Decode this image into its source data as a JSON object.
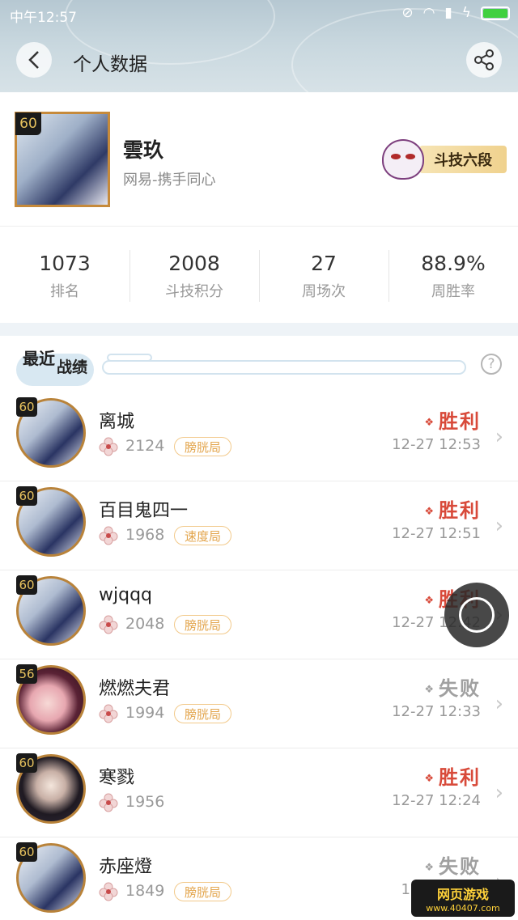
{
  "status_bar": {
    "time": "中午12:57"
  },
  "header": {
    "title": "个人数据"
  },
  "profile": {
    "level": "60",
    "name": "雲玖",
    "server": "网易-携手同心",
    "rank": "斗技六段"
  },
  "stats": [
    {
      "value": "1073",
      "label": "排名"
    },
    {
      "value": "2008",
      "label": "斗技积分"
    },
    {
      "value": "27",
      "label": "周场次"
    },
    {
      "value": "88.9%",
      "label": "周胜率"
    }
  ],
  "section": {
    "title_a": "最近",
    "title_b": "战绩",
    "help": "?"
  },
  "matches": [
    {
      "level": "60",
      "avatar": "shikigami",
      "name": "离城",
      "score": "2124",
      "tag": "膀胱局",
      "result": "胜利",
      "result_type": "win",
      "time": "12-27 12:53"
    },
    {
      "level": "60",
      "avatar": "shikigami",
      "name": "百目鬼四一",
      "score": "1968",
      "tag": "速度局",
      "result": "胜利",
      "result_type": "win",
      "time": "12-27 12:51"
    },
    {
      "level": "60",
      "avatar": "shikigami",
      "name": "wjqqq",
      "score": "2048",
      "tag": "膀胱局",
      "result": "胜利",
      "result_type": "win",
      "time": "12-27 12:42"
    },
    {
      "level": "56",
      "avatar": "girl",
      "name": "燃燃夫君",
      "score": "1994",
      "tag": "膀胱局",
      "result": "失败",
      "result_type": "lose",
      "time": "12-27 12:33"
    },
    {
      "level": "60",
      "avatar": "dark",
      "name": "寒戮",
      "score": "1956",
      "tag": "",
      "result": "胜利",
      "result_type": "win",
      "time": "12-27 12:24"
    },
    {
      "level": "60",
      "avatar": "shikigami",
      "name": "赤座燈",
      "score": "1849",
      "tag": "膀胱局",
      "result": "失败",
      "result_type": "lose",
      "time": "12-27 12:1"
    }
  ],
  "watermark": {
    "line1": "网页游戏",
    "line2": "www.40407.com"
  }
}
